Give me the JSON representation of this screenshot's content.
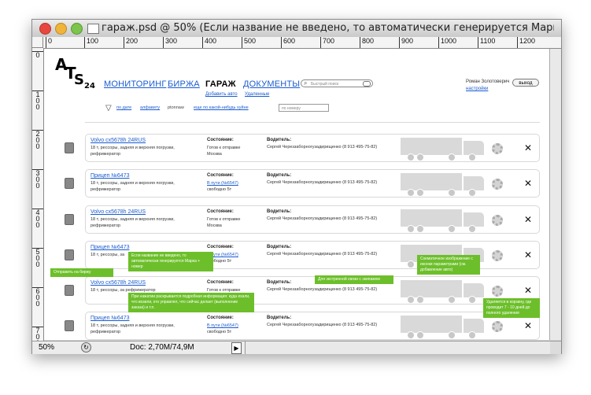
{
  "window": {
    "title": "гараж.psd @ 50% (Если название не введено, то автоматически генерируется Марка ...",
    "zoom": "50%",
    "doc_size": "Doc: 2,70M/74,9M"
  },
  "ruler": {
    "top": [
      "0",
      "100",
      "200",
      "300",
      "400",
      "500",
      "600",
      "700",
      "800",
      "900",
      "1000",
      "1100",
      "1200"
    ],
    "left": [
      "0",
      "1\n0\n0",
      "2\n0\n0",
      "3\n0\n0",
      "4\n0\n0",
      "5\n0\n0",
      "6\n0\n0",
      "7\n0\n0"
    ]
  },
  "logo": {
    "a": "A",
    "t": "T",
    "s": "S",
    "num": "24"
  },
  "nav": {
    "monitoring": "МОНИТОРИНГ",
    "exchange": "БИРЖА",
    "garage": "ГАРАЖ",
    "documents": "ДОКУМЕНТЫ",
    "add_auto": "Добавить авто",
    "deleted": "Удаленные"
  },
  "search": {
    "placeholder": "Быстрый поиск"
  },
  "user": {
    "name": "Роман Золотоверич",
    "settings": "настройки",
    "logout": "выход"
  },
  "filters": {
    "by_date": "по дате",
    "alphabet": "алфавиту",
    "thinking": "ptonnaw",
    "other": "еще по какой-нибудь хуйне",
    "by_number_placeholder": "по номеру"
  },
  "labels": {
    "state": "Состояние:",
    "driver": "Водитель:"
  },
  "rows": [
    {
      "name": "Volvo cx5678h 24RUS",
      "desc": "18 т, рессоры, задняя и верхняя погрузки, рефрижератор",
      "status": "Готов к отправке",
      "status2": "Москва",
      "driver": "Сергей Череззаборногузадирищенко (8 913 495-75-82)"
    },
    {
      "name": "Прицеп №6473",
      "desc": "18 т, рессоры, задняя и верхняя погрузки, рефрижератор",
      "status": "В пути (№6547)",
      "status2": "свободно 5т",
      "driver": "Сергей Череззаборногузадирищенко (8 913 495-75-82)"
    },
    {
      "name": "Volvo cx5678h 24RUS",
      "desc": "18 т, рессоры, задняя и верхняя погрузки, рефрижератор",
      "status": "Готов к отправке",
      "status2": "Москва",
      "driver": "Сергей Череззаборногузадирищенко (8 913 495-75-82)"
    },
    {
      "name": "Прицеп №6473",
      "desc": "18 т, рессоры, за",
      "status": "В пути (№6547)",
      "status2": "свободно 5т",
      "driver": "Сергей Череззаборногузадирищенко (8 913 495-75-82)"
    },
    {
      "name": "Volvo cx5678h 24RUS",
      "desc": "18 т, рессоры, за рефрижератор",
      "status": "Готов к отправке",
      "status2": "",
      "driver": "Сергей Череззаборногузадирищенко (8 913 495-75-82)"
    },
    {
      "name": "Прицеп №6473",
      "desc": "18 т, рессоры, задняя и верхняя погрузки, рефрижератор",
      "status": "В пути (№6547)",
      "status2": "свободно 5т",
      "driver": "Сергей Череззаборногузадирищенко (8 913 495-75-82)"
    }
  ],
  "row_delete": "✕",
  "notes": {
    "send_to_exchange": "Отправить на биржу",
    "auto_name": "Если название не введено, то автоматически генерируется Марка + номер",
    "details": "При нажатии раскрывается подробная информация: куда ехали, что возили, кто управлял, что сейчас делает (выполнение заказа) и т.п.",
    "emergency": "Для экстренной связи с экипажем",
    "schematic": "Схематичное изображение с иконки параметрами (см. добавление авто)",
    "trash": "Удаляется в корзину, где проводит 7 - 10 дней до полного удаления"
  },
  "colors": {
    "note_green": "#6cbf2a",
    "link_blue": "#1a5ccf"
  }
}
